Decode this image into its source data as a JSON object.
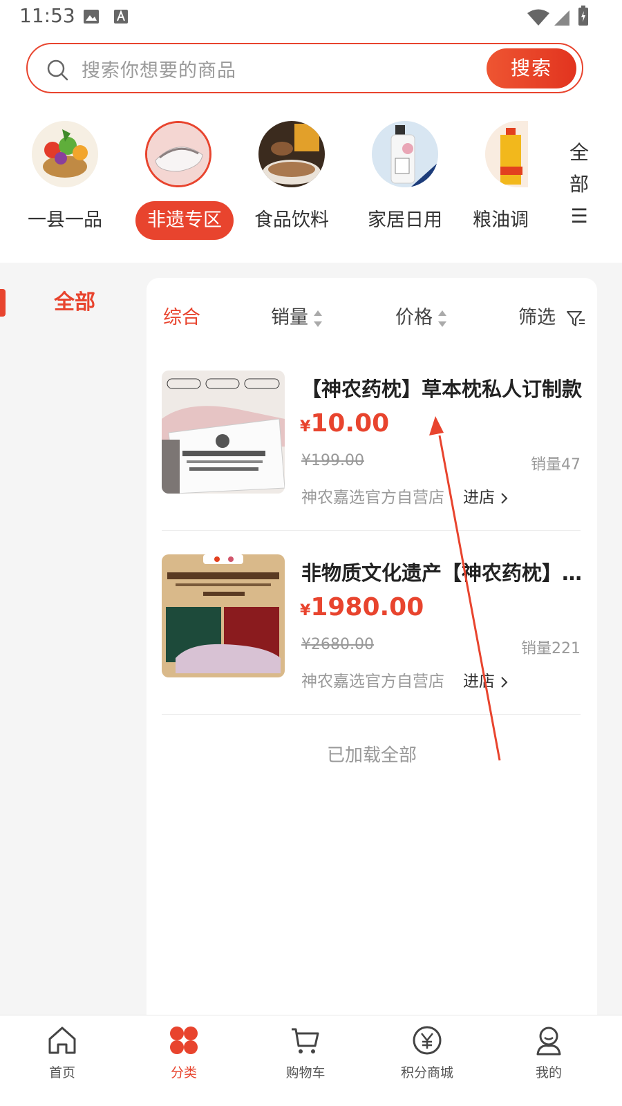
{
  "status_bar": {
    "time": "11:53"
  },
  "search": {
    "placeholder": "搜索你想要的商品",
    "button_label": "搜索"
  },
  "categories": [
    {
      "label": "一县一品",
      "icon": "vegetable-basket-image"
    },
    {
      "label": "非遗专区",
      "icon": "pillow-image",
      "active": true
    },
    {
      "label": "食品饮料",
      "icon": "food-bowl-image"
    },
    {
      "label": "家居日用",
      "icon": "body-wash-image"
    },
    {
      "label": "粮油调",
      "icon": "cooking-oil-image"
    }
  ],
  "all_categories_label": [
    "全",
    "部",
    "☰"
  ],
  "sidebar": {
    "active_label": "全部"
  },
  "sort_bar": {
    "comprehensive": "综合",
    "sales": "销量",
    "price": "价格",
    "filter": "筛选"
  },
  "products": [
    {
      "title": "【神农药枕】草本枕私人订制款",
      "currency": "¥",
      "price": "10.00",
      "original_price": "¥199.00",
      "sales": "销量47",
      "shop": "神农嘉选官方自营店",
      "enter_shop": "进店"
    },
    {
      "title": "非物质文化遗产【神农药枕】礼盒装",
      "currency": "¥",
      "price": "1980.00",
      "original_price": "¥2680.00",
      "sales": "销量221",
      "shop": "神农嘉选官方自营店",
      "enter_shop": "进店"
    }
  ],
  "list_end_text": "已加载全部",
  "tab_bar": [
    {
      "label": "首页",
      "icon": "home-icon"
    },
    {
      "label": "分类",
      "icon": "category-icon",
      "active": true
    },
    {
      "label": "购物车",
      "icon": "cart-icon"
    },
    {
      "label": "积分商城",
      "icon": "points-yen-icon"
    },
    {
      "label": "我的",
      "icon": "profile-icon"
    }
  ],
  "colors": {
    "accent": "#e8442e",
    "background": "#f5f5f5"
  }
}
